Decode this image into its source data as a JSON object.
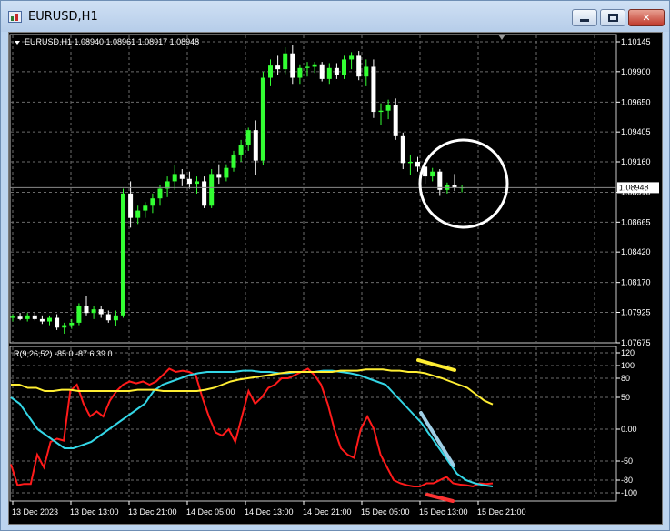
{
  "window": {
    "title": "EURUSD,H1",
    "buttons": {
      "minimize": "minimize",
      "maximize": "maximize",
      "close": "close"
    }
  },
  "main_header": "EURUSD,H1  1.08940 1.08961 1.08917 1.08948",
  "indicator_header": "R(9,26,52) -85.0 -87.6 39.0",
  "current_price_label": "1.08948",
  "colors": {
    "background": "#000000",
    "grid": "#6b6b6b",
    "bull_candle": "#33ff33",
    "bear_candle": "#ffffff",
    "indicator_fast": "#ff1a1a",
    "indicator_mid": "#33d6e6",
    "indicator_slow": "#ffee33"
  },
  "chart_data": [
    {
      "type": "candlestick",
      "symbol": "EURUSD",
      "timeframe": "H1",
      "ylim": [
        1.07675,
        1.10145
      ],
      "y_ticks": [
        "1.10145",
        "1.09900",
        "1.09650",
        "1.09405",
        "1.09160",
        "1.08910",
        "1.08665",
        "1.08420",
        "1.08170",
        "1.07925",
        "1.07675"
      ],
      "x_ticks": [
        "13 Dec 2023",
        "13 Dec 13:00",
        "13 Dec 21:00",
        "14 Dec 05:00",
        "14 Dec 13:00",
        "14 Dec 21:00",
        "15 Dec 05:00",
        "15 Dec 13:00",
        "15 Dec 21:00"
      ],
      "last_price": 1.08948,
      "candles": [
        [
          1.0788,
          1.0791,
          1.0785,
          1.0789
        ],
        [
          1.0789,
          1.0792,
          1.0786,
          1.0787
        ],
        [
          1.0787,
          1.0792,
          1.0785,
          1.079
        ],
        [
          1.079,
          1.0793,
          1.0786,
          1.0787
        ],
        [
          1.0787,
          1.079,
          1.0783,
          1.0785
        ],
        [
          1.0785,
          1.079,
          1.0782,
          1.0788
        ],
        [
          1.0788,
          1.0791,
          1.0778,
          1.078
        ],
        [
          1.078,
          1.0784,
          1.0775,
          1.0782
        ],
        [
          1.0782,
          1.0787,
          1.0779,
          1.0784
        ],
        [
          1.0784,
          1.08,
          1.0782,
          1.0798
        ],
        [
          1.0798,
          1.0806,
          1.079,
          1.0792
        ],
        [
          1.0792,
          1.0798,
          1.0787,
          1.0795
        ],
        [
          1.0795,
          1.0798,
          1.0788,
          1.0791
        ],
        [
          1.0791,
          1.0794,
          1.0784,
          1.0786
        ],
        [
          1.0786,
          1.0794,
          1.0781,
          1.079
        ],
        [
          1.079,
          1.0894,
          1.0788,
          1.089
        ],
        [
          1.089,
          1.09,
          1.0862,
          1.087
        ],
        [
          1.087,
          1.088,
          1.0865,
          1.0876
        ],
        [
          1.0876,
          1.0883,
          1.087,
          1.088
        ],
        [
          1.088,
          1.089,
          1.0874,
          1.0886
        ],
        [
          1.0886,
          1.0897,
          1.088,
          1.0894
        ],
        [
          1.0894,
          1.0904,
          1.0887,
          1.09
        ],
        [
          1.09,
          1.0913,
          1.0893,
          1.0906
        ],
        [
          1.0906,
          1.091,
          1.0896,
          1.0902
        ],
        [
          1.0902,
          1.0908,
          1.0894,
          1.0898
        ],
        [
          1.0898,
          1.0904,
          1.089,
          1.09
        ],
        [
          1.09,
          1.0904,
          1.0878,
          1.088
        ],
        [
          1.088,
          1.091,
          1.0878,
          1.0906
        ],
        [
          1.0906,
          1.0914,
          1.0898,
          1.0903
        ],
        [
          1.0903,
          1.0914,
          1.09,
          1.0911
        ],
        [
          1.0911,
          1.0925,
          1.0908,
          1.0922
        ],
        [
          1.0922,
          1.0934,
          1.0916,
          1.093
        ],
        [
          1.093,
          1.0944,
          1.0925,
          1.0942
        ],
        [
          1.0942,
          1.095,
          1.0905,
          1.0917
        ],
        [
          1.0917,
          1.099,
          1.0913,
          1.0985
        ],
        [
          1.0985,
          1.1,
          1.0978,
          1.0995
        ],
        [
          1.0995,
          1.1003,
          1.0987,
          1.0992
        ],
        [
          1.0992,
          1.101,
          1.0988,
          1.1005
        ],
        [
          1.1005,
          1.1012,
          1.098,
          1.0985
        ],
        [
          1.0985,
          1.0996,
          1.098,
          1.0993
        ],
        [
          1.0993,
          1.0998,
          1.0986,
          1.0994
        ],
        [
          1.0994,
          1.0998,
          1.0989,
          1.0996
        ],
        [
          1.0996,
          1.0998,
          1.0982,
          1.0984
        ],
        [
          1.0984,
          1.0997,
          1.098,
          1.0993
        ],
        [
          1.0993,
          1.0997,
          1.0984,
          1.0987
        ],
        [
          1.0987,
          1.1003,
          1.0984,
          1.1
        ],
        [
          1.1,
          1.1006,
          1.0992,
          1.1003
        ],
        [
          1.1003,
          1.1007,
          1.0983,
          1.0986
        ],
        [
          1.0986,
          1.1,
          1.0978,
          1.0994
        ],
        [
          1.0994,
          1.1,
          1.0952,
          1.0957
        ],
        [
          1.0957,
          1.0964,
          1.0946,
          1.0958
        ],
        [
          1.0958,
          1.0967,
          1.0951,
          1.0963
        ],
        [
          1.0963,
          1.0968,
          1.0934,
          1.0937
        ],
        [
          1.0937,
          1.094,
          1.091,
          1.0915
        ],
        [
          1.0915,
          1.0922,
          1.0905,
          1.0916
        ],
        [
          1.0916,
          1.092,
          1.0908,
          1.0912
        ],
        [
          1.0912,
          1.0915,
          1.0898,
          1.0904
        ],
        [
          1.0904,
          1.0911,
          1.09,
          1.0908
        ],
        [
          1.0908,
          1.091,
          1.0888,
          1.0893
        ],
        [
          1.0893,
          1.0899,
          1.089,
          1.0897
        ],
        [
          1.0897,
          1.0906,
          1.0892,
          1.0895
        ],
        [
          1.0895,
          1.0897,
          1.0891,
          1.0895
        ]
      ]
    },
    {
      "type": "line",
      "title": "R(9,26,52)",
      "ylim": [
        -110,
        120
      ],
      "y_ticks": [
        "120",
        "100",
        "80",
        "50",
        "0.00",
        "-50",
        "-80",
        "-100"
      ],
      "values_shown": [
        -85.0,
        -87.6,
        39.0
      ],
      "series": [
        {
          "values": [
            -55,
            -88,
            -86,
            -86,
            -40,
            -60,
            -20,
            -15,
            -18,
            60,
            70,
            40,
            20,
            28,
            20,
            45,
            60,
            70,
            75,
            72,
            75,
            70,
            75,
            85,
            95,
            90,
            92,
            90,
            85,
            50,
            20,
            -5,
            -10,
            0,
            -20,
            20,
            60,
            40,
            50,
            65,
            70,
            80,
            80,
            85,
            90,
            95,
            85,
            70,
            40,
            0,
            -30,
            -40,
            -45,
            0,
            20,
            0,
            -40,
            -60,
            -80,
            -85,
            -88,
            -90,
            -90,
            -85,
            -85,
            -80,
            -75,
            -85,
            -87,
            -88,
            -90,
            -85,
            -86,
            -85
          ]
        },
        {
          "values": [
            50,
            40,
            20,
            0,
            -10,
            -20,
            -30,
            -30,
            -25,
            -20,
            -10,
            0,
            10,
            20,
            30,
            40,
            60,
            70,
            75,
            80,
            85,
            88,
            90,
            90,
            90,
            90,
            92,
            92,
            90,
            90,
            88,
            88,
            90,
            90,
            90,
            92,
            92,
            90,
            88,
            85,
            80,
            75,
            70,
            55,
            40,
            25,
            10,
            -10,
            -30,
            -50,
            -70,
            -80,
            -85,
            -88,
            -90
          ]
        },
        {
          "values": [
            70,
            70,
            65,
            65,
            60,
            60,
            62,
            62,
            60,
            60,
            60,
            60,
            60,
            60,
            60,
            62,
            62,
            62,
            60,
            60,
            60,
            60,
            60,
            62,
            65,
            70,
            75,
            78,
            80,
            82,
            84,
            86,
            88,
            90,
            90,
            90,
            90,
            90,
            90,
            92,
            92,
            92,
            94,
            94,
            94,
            92,
            92,
            90,
            90,
            88,
            84,
            80,
            75,
            70,
            65,
            55,
            45,
            39
          ]
        }
      ]
    }
  ]
}
